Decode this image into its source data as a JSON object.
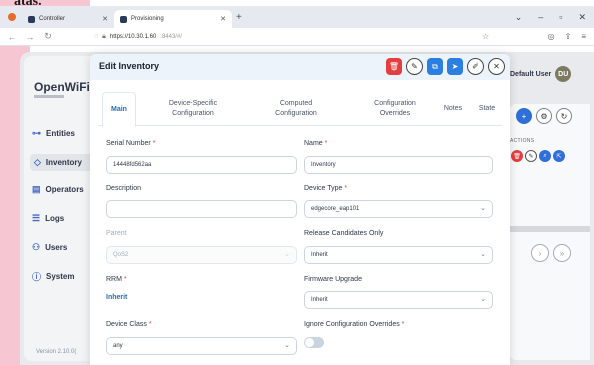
{
  "browser": {
    "tabs": [
      {
        "label": "Controller",
        "active": false
      },
      {
        "label": "Provisioning",
        "active": true
      }
    ],
    "new_tab": "+",
    "url_host": "https://10.30.1.60",
    "url_rest": ":8443/#/"
  },
  "page_fragment": "atas.",
  "app": {
    "brand": "OpenWiFi",
    "nav": [
      {
        "label": "Entities",
        "icon": "entities-icon",
        "glyph": "⊶"
      },
      {
        "label": "Inventory",
        "icon": "inventory-icon",
        "glyph": "◇"
      },
      {
        "label": "Operators",
        "icon": "operators-icon",
        "glyph": "▤"
      },
      {
        "label": "Logs",
        "icon": "logs-icon",
        "glyph": "☰"
      },
      {
        "label": "Users",
        "icon": "users-icon",
        "glyph": "⚇"
      },
      {
        "label": "System",
        "icon": "system-icon",
        "glyph": "ⓘ"
      }
    ],
    "version": "Version 2.10.0(",
    "user": {
      "name": "Default User",
      "initials": "DU"
    },
    "actions_header": "ACTIONS"
  },
  "modal": {
    "title": "Edit Inventory",
    "tabs": [
      {
        "label": "Main",
        "selected": true
      },
      {
        "label": "Device-Specific Configuration",
        "selected": false
      },
      {
        "label": "Computed Configuration",
        "selected": false
      },
      {
        "label": "Configuration Overrides",
        "selected": false
      },
      {
        "label": "Notes",
        "selected": false
      },
      {
        "label": "State",
        "selected": false
      }
    ],
    "fields": {
      "serial_number": {
        "label": "Serial Number",
        "required": "*",
        "value": "14448fd562aa"
      },
      "name": {
        "label": "Name",
        "required": "*",
        "value": "Inventory"
      },
      "description": {
        "label": "Description",
        "value": ""
      },
      "device_type": {
        "label": "Device Type",
        "required": "*",
        "value": "edgecore_eap101"
      },
      "parent": {
        "label": "Parent",
        "value": "QoS2"
      },
      "release_candidates": {
        "label": "Release Candidates Only",
        "value": "Inherit"
      },
      "rrm": {
        "label": "RRM",
        "required": "*",
        "value": "Inherit"
      },
      "firmware_upgrade": {
        "label": "Firmware Upgrade",
        "value": "Inherit"
      },
      "device_class": {
        "label": "Device Class",
        "required": "*",
        "value": "any"
      },
      "ignore_overrides": {
        "label": "Ignore Configuration Overrides",
        "required": "*",
        "value": "off"
      }
    }
  },
  "colors": {
    "accent": "#2b6cb0",
    "danger": "#e53e3e",
    "primary_button": "#2b7fe0",
    "header_bg": "#edf3fb"
  }
}
